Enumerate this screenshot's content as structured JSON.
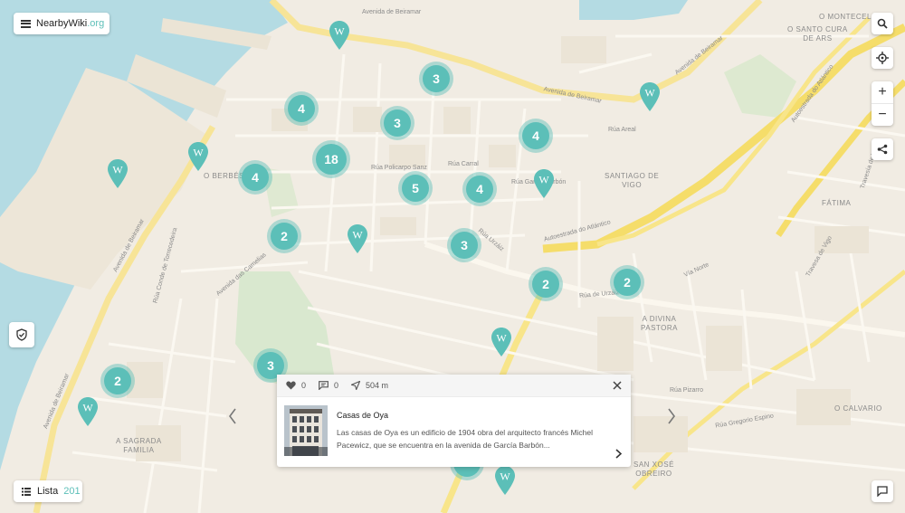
{
  "app": {
    "brand_main": "NearbyWiki",
    "brand_tld": ".org"
  },
  "list_button": {
    "label": "Lista",
    "count": "201"
  },
  "districts": [
    {
      "id": "montecelo",
      "text": "O MONTECELO"
    },
    {
      "id": "santo-cura",
      "text": "O SANTO CURA\nDE ARS"
    },
    {
      "id": "berbes",
      "text": "O BERBÉS"
    },
    {
      "id": "santiago",
      "text": "SANTIAGO DE\nVIGO"
    },
    {
      "id": "fatima",
      "text": "FÁTIMA"
    },
    {
      "id": "pastora",
      "text": "A DIVINA\nPASTORA"
    },
    {
      "id": "familia",
      "text": "A SAGRADA\nFAMILIA"
    },
    {
      "id": "calvario",
      "text": "O CALVARIO"
    },
    {
      "id": "obreiro",
      "text": "SAN XOSÉ\nOBREIRO"
    }
  ],
  "streets": [
    {
      "id": "beiramar1",
      "text": "Avenida de Beiramar"
    },
    {
      "id": "beiramar2",
      "text": "Avenida de Beiramar"
    },
    {
      "id": "beiramar3",
      "text": "Avenida de Beiramar"
    },
    {
      "id": "beiramar4",
      "text": "Avenida de Beiramar"
    },
    {
      "id": "beiramar5",
      "text": "Avenida de Beiramar"
    },
    {
      "id": "atlantico1",
      "text": "Autoestrada do Atlántico"
    },
    {
      "id": "atlantico2",
      "text": "Autoestrada do Atlántico"
    },
    {
      "id": "camelias",
      "text": "Avenida das Camelias"
    },
    {
      "id": "urzaiz",
      "text": "Rúa de Urzáiz"
    },
    {
      "id": "urzaiz2",
      "text": "Rúa Urzáiz"
    },
    {
      "id": "policarpo",
      "text": "Rúa Policarpo Sanz"
    },
    {
      "id": "garcia",
      "text": "Rúa García Barbón"
    },
    {
      "id": "carral",
      "text": "Rúa Carral"
    },
    {
      "id": "areal",
      "text": "Rúa Areal"
    },
    {
      "id": "pizarro",
      "text": "Rúa Pizarro"
    },
    {
      "id": "gregorio",
      "text": "Rúa Gregorio Espino"
    },
    {
      "id": "vianorte",
      "text": "Vía Norte"
    },
    {
      "id": "torrecedeira",
      "text": "Rúa Conde de Torrecedeira"
    },
    {
      "id": "travesa",
      "text": "Travesía de Vigo"
    },
    {
      "id": "travesa2",
      "text": "Travesa de Vigo"
    }
  ],
  "clusters": [
    "3",
    "4",
    "3",
    "4",
    "18",
    "4",
    "5",
    "4",
    "2",
    "3",
    "2",
    "2",
    "3",
    "2"
  ],
  "popup": {
    "likes": "0",
    "comments": "0",
    "distance": "504 m",
    "title": "Casas de Oya",
    "description": "Las casas de Oya es un edificio de 1904 obra del arquitecto francés Michel Pacewicz, que se encuentra en la avenida de García Barbón..."
  },
  "icons": [
    "menu-icon",
    "search-icon",
    "locate-icon",
    "zoom-in-icon",
    "zoom-out-icon",
    "share-icon",
    "shield-icon",
    "list-icon",
    "comment-icon",
    "heart-icon",
    "close-icon",
    "chevron-left-icon",
    "chevron-right-icon",
    "wikipedia-marker-icon"
  ],
  "colors": {
    "accent": "#5cbfb8",
    "water": "#b4dbe3",
    "land": "#f2ede4",
    "park": "#d9e8cf",
    "highway": "#f8e58a"
  }
}
